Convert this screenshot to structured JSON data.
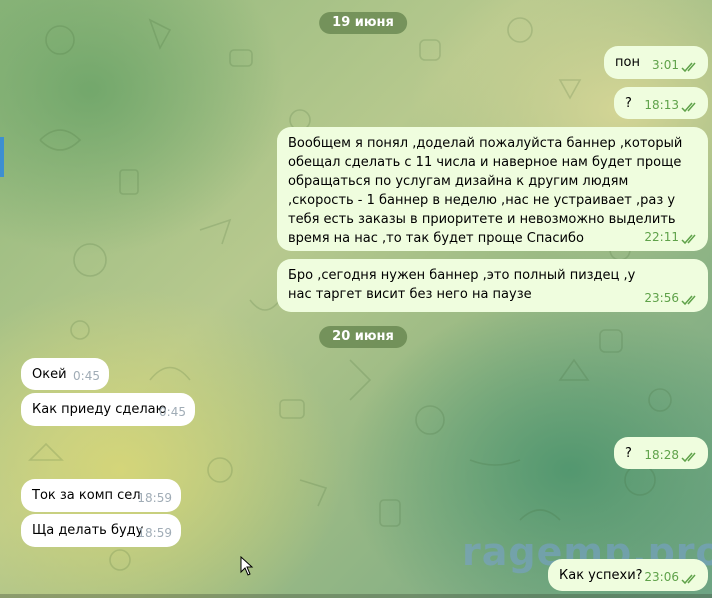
{
  "dates": [
    "19 июня",
    "20 июня"
  ],
  "messages": [
    {
      "text": "пон",
      "time": "3:01"
    },
    {
      "text": "?",
      "time": "18:13"
    },
    {
      "text": "Вообщем я понял ,доделай пожалуйста баннер ,который обещал сделать с 11 числа и наверное нам будет проще обращаться по услугам дизайна к другим людям ,скорость - 1 баннер в неделю ,нас не устраивает ,раз у тебя есть заказы в приоритете и невозможно выделить время на нас ,то так будет проще Спасибо",
      "time": "22:11"
    },
    {
      "text": "Бро ,сегодня нужен баннер ,это полный пиздец ,у нас таргет висит без него на паузе",
      "time": "23:56"
    },
    {
      "text": "Окей",
      "time": "0:45"
    },
    {
      "text": "Как приеду сделаю",
      "time": "0:45"
    },
    {
      "text": "?",
      "time": "18:28"
    },
    {
      "text": "Ток за комп сел",
      "time": "18:59"
    },
    {
      "text": "Ща делать буду",
      "time": "18:59"
    },
    {
      "text": "Как успехи?",
      "time": "23:06"
    }
  ],
  "watermark": "ragemp.pro",
  "colors": {
    "outgoing_bubble": "#effdde",
    "incoming_bubble": "#ffffff",
    "checkmarks": "#5fa24a",
    "date_pill": "#60804a"
  }
}
